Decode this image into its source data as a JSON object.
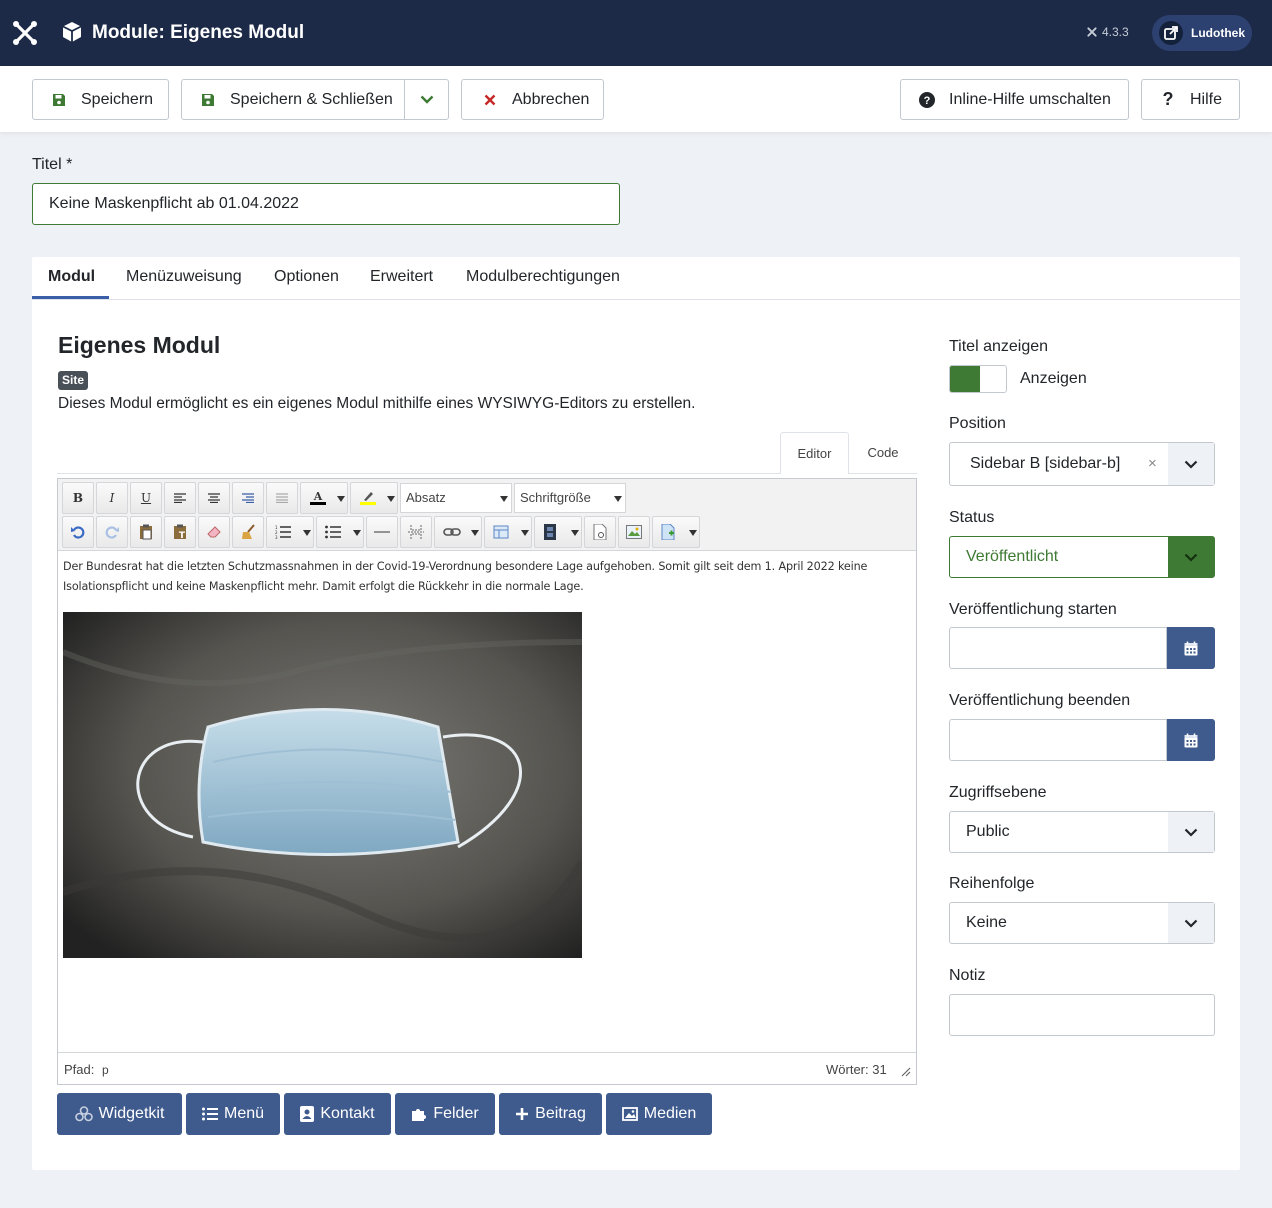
{
  "header": {
    "page_title": "Module: Eigenes Modul",
    "version": "4.3.3",
    "user_label": "Ludothek"
  },
  "toolbar": {
    "save": "Speichern",
    "save_close": "Speichern & Schließen",
    "cancel": "Abbrechen",
    "inline_help": "Inline-Hilfe umschalten",
    "help": "Hilfe"
  },
  "title_field": {
    "label": "Titel *",
    "value": "Keine Maskenpflicht ab 01.04.2022"
  },
  "tabs": [
    "Modul",
    "Menüzuweisung",
    "Optionen",
    "Erweitert",
    "Modulberechtigungen"
  ],
  "module": {
    "heading": "Eigenes Modul",
    "badge": "Site",
    "description": "Dieses Modul ermöglicht es ein eigenes Modul mithilfe eines WYSIWYG-Editors zu erstellen."
  },
  "editor": {
    "tab_editor": "Editor",
    "tab_code": "Code",
    "format_select": "Absatz",
    "fontsize_select": "Schriftgröße",
    "content_text": "Der Bundesrat hat die letzten Schutzmassnahmen in der Covid-19-Verordnung besondere Lage aufgehoben. Somit gilt seit dem 1. April 2022 keine Isolationspflicht und keine Maskenpflicht mehr. Damit erfolgt die Rückkehr in die normale Lage.",
    "path_label": "Pfad:",
    "path_value": "p",
    "word_count": "Wörter: 31"
  },
  "editor_buttons": [
    "Widgetkit",
    "Menü",
    "Kontakt",
    "Felder",
    "Beitrag",
    "Medien"
  ],
  "sidebar": {
    "show_title_label": "Titel anzeigen",
    "show_title_value": "Anzeigen",
    "position_label": "Position",
    "position_value": "Sidebar B [sidebar-b]",
    "position_clear": "×",
    "status_label": "Status",
    "status_value": "Veröffentlicht",
    "publish_up_label": "Veröffentlichung starten",
    "publish_down_label": "Veröffentlichung beenden",
    "access_label": "Zugriffsebene",
    "access_value": "Public",
    "ordering_label": "Reihenfolge",
    "ordering_value": "Keine",
    "note_label": "Notiz"
  },
  "colors": {
    "header_bg": "#1c2a47",
    "accent_blue": "#3f5a8c",
    "success_green": "#3e7a34",
    "cancel_red": "#c52827"
  }
}
